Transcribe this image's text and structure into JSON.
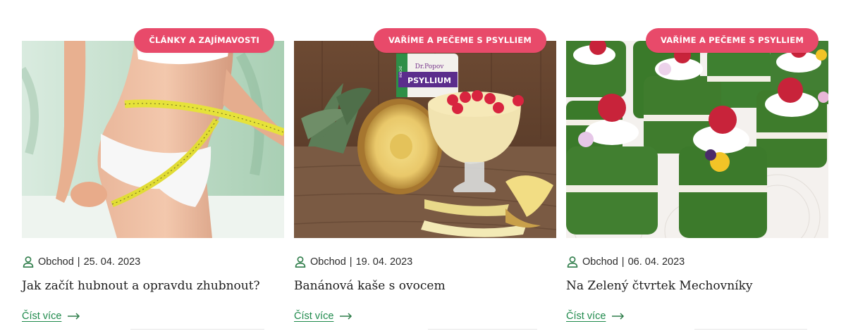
{
  "colors": {
    "badge": "#e84a6a",
    "link": "#1f8a4c",
    "icon": "#2f7d4a",
    "text": "#2b2b2b"
  },
  "posts": [
    {
      "category": "ČLÁNKY A ZAJÍMAVOSTI",
      "author": "Obchod",
      "separator": "|",
      "date": "25. 04. 2023",
      "title": "Jak začít hubnout a opravdu zhubnout?",
      "read_more": "Číst více",
      "image": "woman-measuring-waist-photo"
    },
    {
      "category": "VAŘÍME A PEČEME S PSYLLIEM",
      "author": "Obchod",
      "separator": "|",
      "date": "19. 04. 2023",
      "title": "Banánová kaše s ovocem",
      "read_more": "Číst více",
      "image": "banana-pudding-pineapple-photo"
    },
    {
      "category": "VAŘÍME A PEČEME S PSYLLIEM",
      "author": "Obchod",
      "separator": "|",
      "date": "06. 04. 2023",
      "title": "Na Zelený čtvrtek Mechovníky",
      "read_more": "Číst více",
      "image": "green-moss-cakes-photo"
    }
  ],
  "product_label": {
    "brand": "Dr.Popov",
    "name": "PSYLLIUM",
    "strip": "INDICKÉ"
  }
}
